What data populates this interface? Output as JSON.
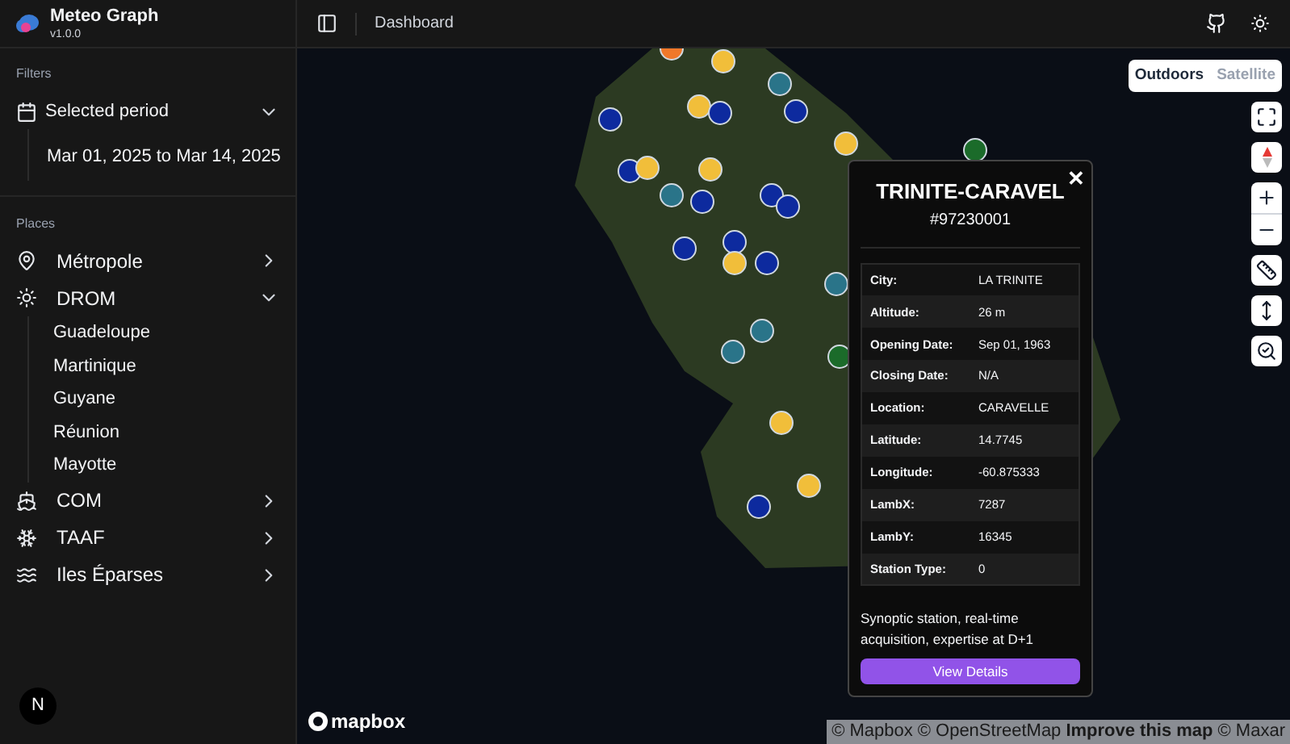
{
  "app": {
    "name": "Meteo Graph",
    "version": "v1.0.0"
  },
  "filters": {
    "heading": "Filters",
    "period": {
      "label": "Selected period",
      "expanded": true,
      "value": "Mar 01, 2025 to Mar 14, 2025"
    }
  },
  "places": {
    "heading": "Places",
    "items": [
      {
        "label": "Métropole",
        "expanded": false
      },
      {
        "label": "DROM",
        "expanded": true,
        "children": [
          {
            "label": "Guadeloupe"
          },
          {
            "label": "Martinique"
          },
          {
            "label": "Guyane"
          },
          {
            "label": "Réunion"
          },
          {
            "label": "Mayotte"
          }
        ]
      },
      {
        "label": "COM",
        "expanded": false
      },
      {
        "label": "TAAF",
        "expanded": false
      },
      {
        "label": "Iles Éparses",
        "expanded": false
      }
    ]
  },
  "header": {
    "breadcrumb": "Dashboard"
  },
  "map": {
    "styles": [
      {
        "label": "Outdoors",
        "selected": true
      },
      {
        "label": "Satellite",
        "selected": false
      }
    ],
    "logo": "mapbox",
    "attribution": [
      {
        "label": "© Mapbox",
        "kind": "link"
      },
      {
        "label": "© OpenStreetMap",
        "kind": "link"
      },
      {
        "label": "Improve this map",
        "kind": "strong"
      },
      {
        "label": "© Maxar",
        "kind": "link"
      }
    ]
  },
  "popup": {
    "title": "TRINITE-CARAVEL",
    "id": "#97230001",
    "close": "✕",
    "rows": [
      {
        "label": "City:",
        "value": "LA TRINITE"
      },
      {
        "label": "Altitude:",
        "value": "26 m"
      },
      {
        "label": "Opening Date:",
        "value": "Sep 01, 1963"
      },
      {
        "label": "Closing Date:",
        "value": "N/A"
      },
      {
        "label": "Location:",
        "value": "CARAVELLE"
      },
      {
        "label": "Latitude:",
        "value": "14.7745"
      },
      {
        "label": "Longitude:",
        "value": "-60.875333"
      },
      {
        "label": "LambX:",
        "value": "7287"
      },
      {
        "label": "LambY:",
        "value": "16345"
      },
      {
        "label": "Station Type:",
        "value": "0"
      }
    ],
    "description": "Synoptic station, real-time acquisition, expertise at D+1",
    "button": "View Details"
  },
  "badge": "N"
}
